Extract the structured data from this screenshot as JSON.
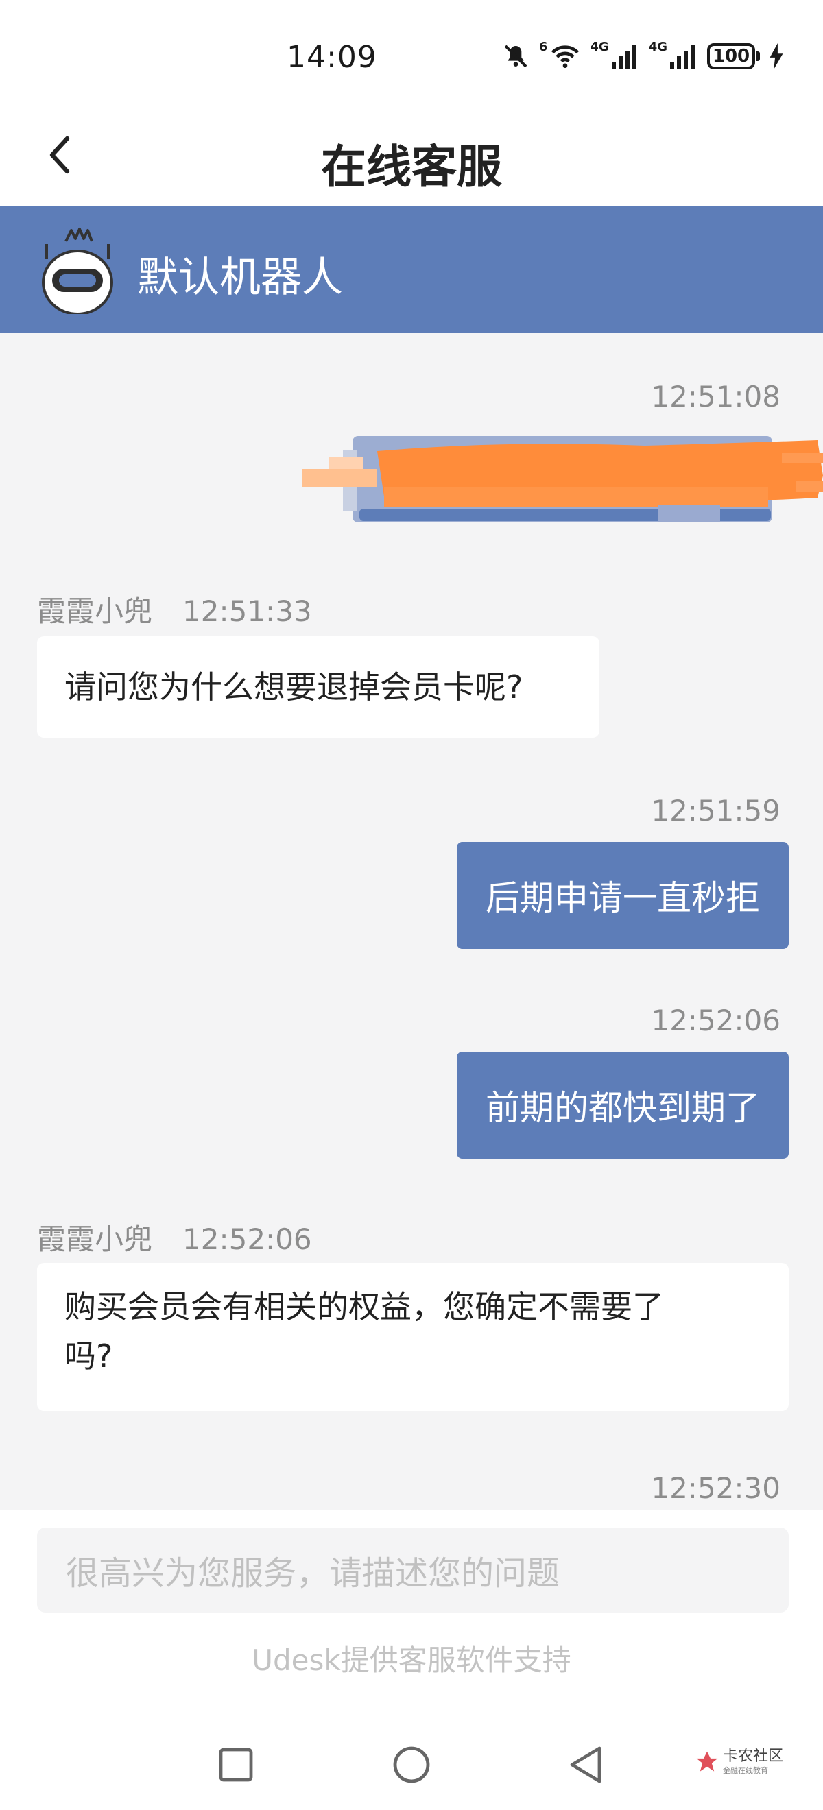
{
  "status_bar": {
    "time": "14:09",
    "icons": [
      "mute-bell-icon",
      "wifi-icon",
      "signal-4g-icon",
      "signal-4g-icon",
      "battery-icon",
      "charging-icon"
    ],
    "wifi_label": "6",
    "sim1_label": "4G",
    "sim2_label": "4G",
    "battery": "100"
  },
  "title_bar": {
    "title": "在线客服",
    "back_icon": "chevron-left-icon"
  },
  "agent_header": {
    "name": "默认机器人",
    "avatar_icon": "robot-icon",
    "color": "#5d7db8"
  },
  "messages": [
    {
      "from": "user",
      "time": "12:51:08",
      "redacted": true
    },
    {
      "from": "agent",
      "sender": "霞霞小兜",
      "time": "12:51:33",
      "text": "请问您为什么想要退掉会员卡呢?"
    },
    {
      "from": "user",
      "time": "12:51:59",
      "text": "后期申请一直秒拒"
    },
    {
      "from": "user",
      "time": "12:52:06",
      "text": "前期的都快到期了"
    },
    {
      "from": "agent",
      "sender": "霞霞小兜",
      "time": "12:52:06",
      "text_line1": "购买会员会有相关的权益，您确定不需要了",
      "text_line2": "吗?"
    },
    {
      "from": "user",
      "time": "12:52:30",
      "partially_visible": true
    }
  ],
  "input": {
    "placeholder": "很高兴为您服务，请描述您的问题"
  },
  "footer": {
    "powered_by": "Udesk提供客服软件支持"
  },
  "nav_bar": {
    "buttons": [
      "recents-square-icon",
      "home-circle-icon",
      "back-triangle-icon"
    ],
    "watermark": "卡农社区",
    "watermark_sub": "金融在线教育"
  },
  "colors": {
    "accent": "#5d7db8",
    "background": "#f4f4f5",
    "redaction": "#ff8c3a"
  }
}
